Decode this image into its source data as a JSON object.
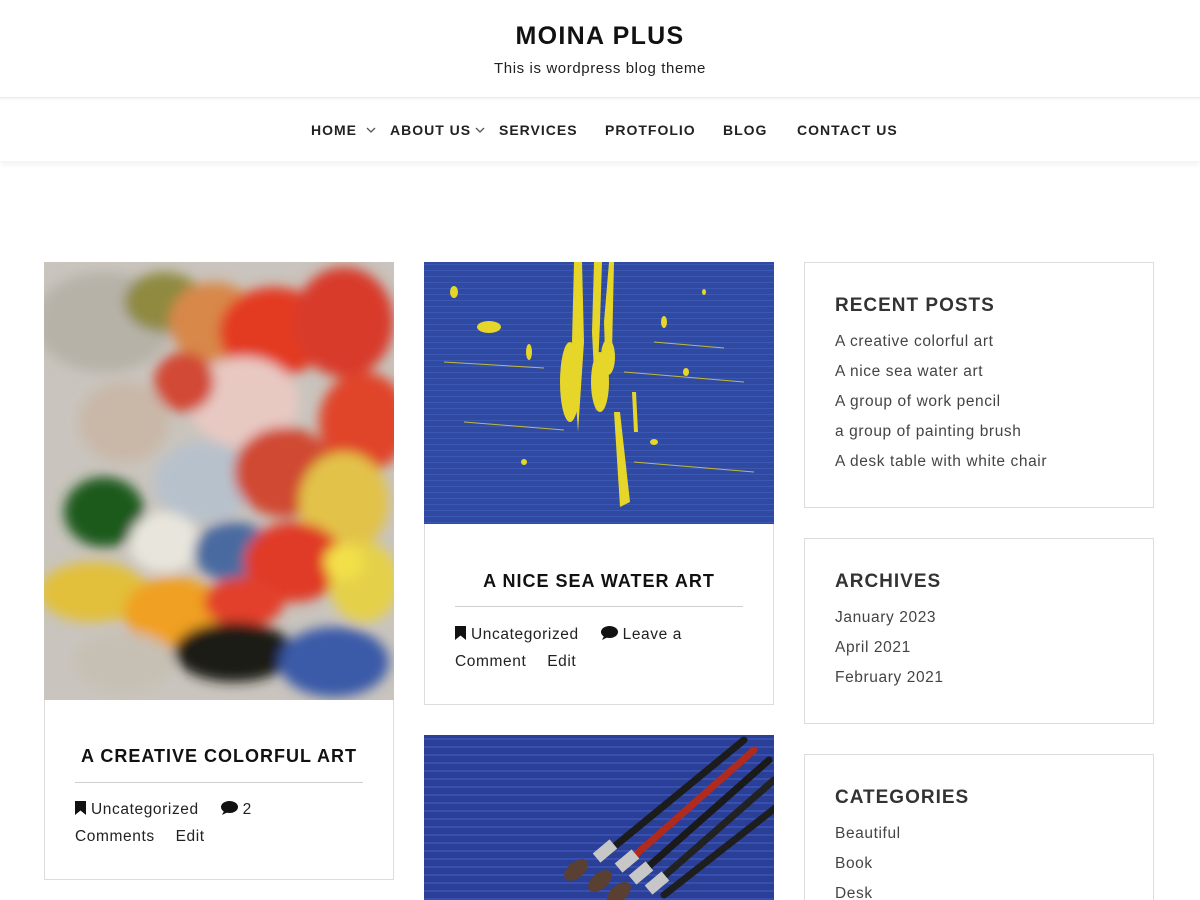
{
  "site": {
    "title": "MOINA PLUS",
    "description": "This is wordpress blog theme"
  },
  "nav": {
    "items": [
      {
        "label": "HOME",
        "has_submenu": true
      },
      {
        "label": "ABOUT US",
        "has_submenu": true
      },
      {
        "label": "SERVICES",
        "has_submenu": false
      },
      {
        "label": "PROTFOLIO",
        "has_submenu": false
      },
      {
        "label": "BLOG",
        "has_submenu": false
      },
      {
        "label": "CONTACT US",
        "has_submenu": false
      }
    ]
  },
  "posts": [
    {
      "title": "A CREATIVE COLORFUL ART",
      "category": "Uncategorized",
      "comments_line1": "2",
      "comments_line2": "Comments",
      "edit": "Edit",
      "image": "colorful-paint-palette"
    },
    {
      "title": "A NICE SEA WATER ART",
      "category": "Uncategorized",
      "comments_line1": "Leave a",
      "comments_line2": "Comment",
      "edit": "Edit",
      "image": "yellow-paint-on-blue"
    },
    {
      "title": "",
      "image": "paint-brushes-on-blue"
    }
  ],
  "sidebar": {
    "recent_posts": {
      "title": "RECENT POSTS",
      "items": [
        "A creative colorful art",
        "A nice sea water art",
        "A group of work pencil",
        "a group of painting brush",
        "A desk table with white chair"
      ]
    },
    "archives": {
      "title": "ARCHIVES",
      "items": [
        "January 2023",
        "April 2021",
        "February 2021"
      ]
    },
    "categories": {
      "title": "CATEGORIES",
      "items": [
        "Beautiful",
        "Book",
        "Desk"
      ]
    }
  },
  "icons": {
    "category": "bookmark-icon",
    "comments": "comment-icon",
    "submenu": "chevron-down-icon"
  }
}
